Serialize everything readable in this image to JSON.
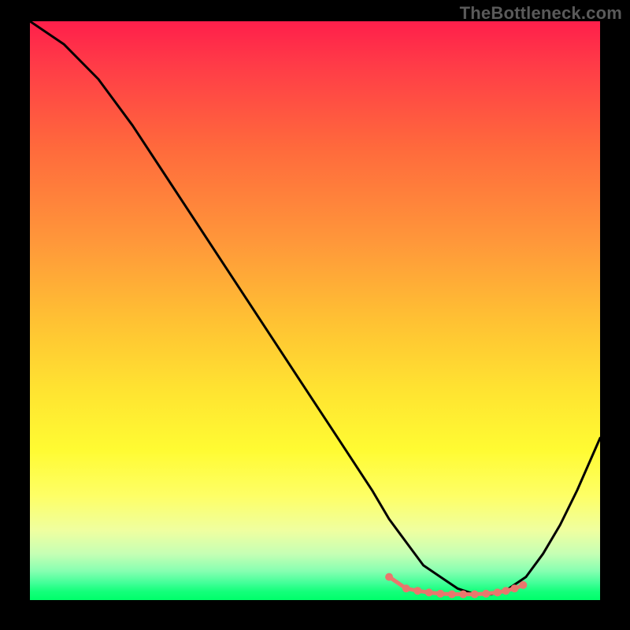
{
  "watermark": "TheBottleneck.com",
  "chart_data": {
    "type": "line",
    "title": "",
    "xlabel": "",
    "ylabel": "",
    "xlim": [
      0,
      100
    ],
    "ylim": [
      0,
      100
    ],
    "series": [
      {
        "name": "curve",
        "x": [
          0,
          6,
          12,
          18,
          24,
          30,
          36,
          42,
          48,
          54,
          60,
          63,
          66,
          69,
          72,
          75,
          78,
          81,
          84,
          87,
          90,
          93,
          96,
          100
        ],
        "values": [
          100,
          96,
          90,
          82,
          73,
          64,
          55,
          46,
          37,
          28,
          19,
          14,
          10,
          6,
          4,
          2,
          1,
          1,
          2,
          4,
          8,
          13,
          19,
          28
        ]
      }
    ],
    "markers": {
      "name": "highlight-dots",
      "x": [
        63,
        66,
        68,
        70,
        72,
        74,
        76,
        78,
        80,
        82,
        83.5,
        85,
        86.5
      ],
      "values": [
        4,
        2,
        1.6,
        1.3,
        1.1,
        1.0,
        1.0,
        1.0,
        1.1,
        1.3,
        1.6,
        2.0,
        2.6
      ]
    },
    "marker_color": "#e9776d"
  }
}
